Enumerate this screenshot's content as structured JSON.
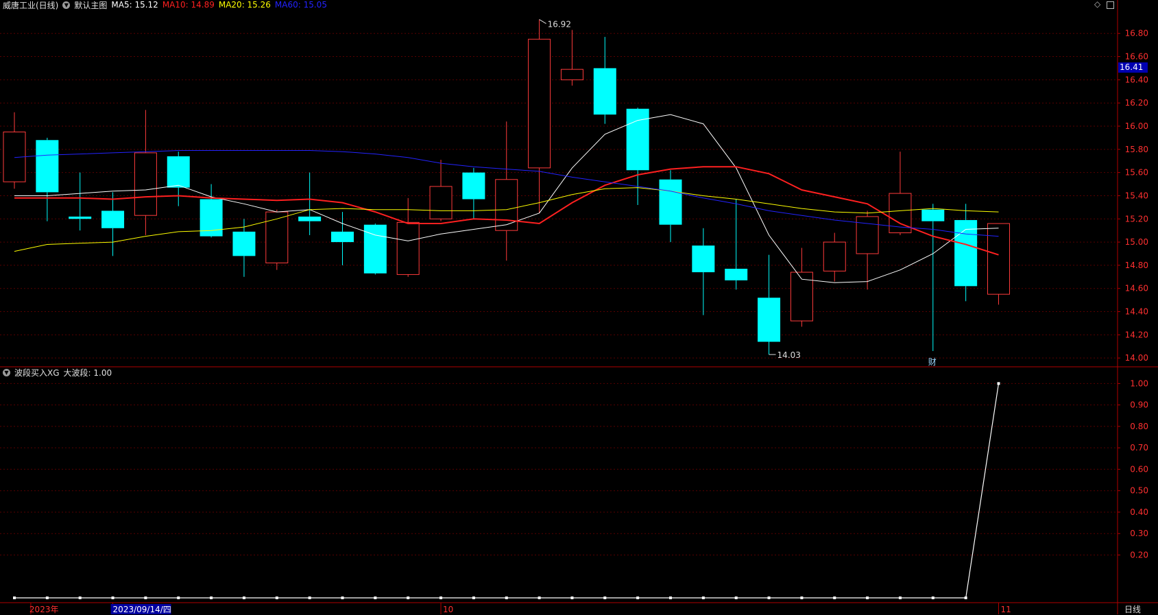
{
  "header": {
    "stock_title": "威唐工业(日线)",
    "main_chart_label": "默认主图",
    "ma": [
      {
        "label": "MA5: 15.12",
        "color": "#ffffff"
      },
      {
        "label": "MA10: 14.89",
        "color": "#ff2020"
      },
      {
        "label": "MA20: 15.26",
        "color": "#ffff00"
      },
      {
        "label": "MA60: 15.05",
        "color": "#2323ff"
      }
    ]
  },
  "sub_header": {
    "indicator_label": "波段买入XG",
    "value_label": "大波段: 1.00"
  },
  "price_badge": "16.41",
  "corner_label": "日线",
  "colors": {
    "up": "#ff3b3b",
    "down": "#00ffff",
    "grid": "#5a0000",
    "axis": "#b00000"
  },
  "chart_data": [
    {
      "type": "candlestick",
      "title": "",
      "yticks": [
        "14.00",
        "14.20",
        "14.40",
        "14.60",
        "14.80",
        "15.00",
        "15.20",
        "15.40",
        "15.60",
        "15.80",
        "16.00",
        "16.20",
        "16.40",
        "16.60",
        "16.80"
      ],
      "ylim": [
        13.93,
        16.97
      ],
      "high_label": "16.92",
      "low_label": "14.03",
      "event_marker": "财",
      "x_labels": [
        {
          "text": "2023年",
          "index": 0.5
        },
        {
          "text": "2023/09/14/四",
          "index": 3
        },
        {
          "text": "10",
          "index": 13
        },
        {
          "text": "11",
          "index": 30
        }
      ],
      "candles": [
        {
          "o": 15.52,
          "h": 16.12,
          "l": 15.46,
          "c": 15.95
        },
        {
          "o": 15.88,
          "h": 15.9,
          "l": 15.18,
          "c": 15.43
        },
        {
          "o": 15.22,
          "h": 15.6,
          "l": 15.1,
          "c": 15.2
        },
        {
          "o": 15.27,
          "h": 15.43,
          "l": 14.88,
          "c": 15.12
        },
        {
          "o": 15.23,
          "h": 16.14,
          "l": 15.06,
          "c": 15.77
        },
        {
          "o": 15.74,
          "h": 15.78,
          "l": 15.31,
          "c": 15.47
        },
        {
          "o": 15.37,
          "h": 15.5,
          "l": 15.04,
          "c": 15.05
        },
        {
          "o": 15.09,
          "h": 15.2,
          "l": 14.7,
          "c": 14.88
        },
        {
          "o": 14.82,
          "h": 15.28,
          "l": 14.76,
          "c": 15.26
        },
        {
          "o": 15.22,
          "h": 15.6,
          "l": 15.06,
          "c": 15.18
        },
        {
          "o": 15.09,
          "h": 15.26,
          "l": 14.8,
          "c": 15.0
        },
        {
          "o": 15.15,
          "h": 15.16,
          "l": 14.72,
          "c": 14.73
        },
        {
          "o": 14.72,
          "h": 15.38,
          "l": 14.7,
          "c": 15.17
        },
        {
          "o": 15.2,
          "h": 15.71,
          "l": 15.18,
          "c": 15.48
        },
        {
          "o": 15.6,
          "h": 15.64,
          "l": 15.2,
          "c": 15.37
        },
        {
          "o": 15.1,
          "h": 16.04,
          "l": 14.84,
          "c": 15.54
        },
        {
          "o": 15.64,
          "h": 16.92,
          "l": 15.25,
          "c": 16.75
        },
        {
          "o": 16.4,
          "h": 16.83,
          "l": 16.35,
          "c": 16.49
        },
        {
          "o": 16.5,
          "h": 16.77,
          "l": 16.02,
          "c": 16.1
        },
        {
          "o": 16.15,
          "h": 16.16,
          "l": 15.32,
          "c": 15.62
        },
        {
          "o": 15.54,
          "h": 15.62,
          "l": 15.0,
          "c": 15.15
        },
        {
          "o": 14.97,
          "h": 15.12,
          "l": 14.37,
          "c": 14.74
        },
        {
          "o": 14.77,
          "h": 15.37,
          "l": 14.59,
          "c": 14.67
        },
        {
          "o": 14.52,
          "h": 14.89,
          "l": 14.03,
          "c": 14.14
        },
        {
          "o": 14.32,
          "h": 14.95,
          "l": 14.27,
          "c": 14.74
        },
        {
          "o": 14.75,
          "h": 15.08,
          "l": 14.66,
          "c": 15.0
        },
        {
          "o": 14.9,
          "h": 15.27,
          "l": 14.59,
          "c": 15.22
        },
        {
          "o": 15.08,
          "h": 15.78,
          "l": 15.06,
          "c": 15.42
        },
        {
          "o": 15.28,
          "h": 15.33,
          "l": 14.06,
          "c": 15.18
        },
        {
          "o": 15.19,
          "h": 15.33,
          "l": 14.49,
          "c": 14.62
        },
        {
          "o": 14.55,
          "h": 15.16,
          "l": 14.46,
          "c": 15.16
        }
      ],
      "series": [
        {
          "name": "MA5",
          "color": "#ffffff",
          "width": 1,
          "values": [
            15.4,
            15.4,
            15.42,
            15.44,
            15.45,
            15.49,
            15.39,
            15.33,
            15.26,
            15.28,
            15.16,
            15.06,
            15.01,
            15.07,
            15.11,
            15.15,
            15.25,
            15.64,
            15.93,
            16.05,
            16.1,
            16.02,
            15.64,
            15.06,
            14.68,
            14.65,
            14.66,
            14.76,
            14.9,
            15.11,
            15.12
          ]
        },
        {
          "name": "MA10",
          "color": "#ff2020",
          "width": 2,
          "values": [
            15.38,
            15.38,
            15.38,
            15.37,
            15.39,
            15.4,
            15.38,
            15.37,
            15.36,
            15.37,
            15.34,
            15.26,
            15.16,
            15.16,
            15.2,
            15.19,
            15.16,
            15.34,
            15.49,
            15.58,
            15.63,
            15.65,
            15.65,
            15.59,
            15.45,
            15.39,
            15.33,
            15.16,
            15.05,
            14.98,
            14.89
          ]
        },
        {
          "name": "MA20",
          "color": "#ffff00",
          "width": 1,
          "values": [
            14.92,
            14.98,
            14.99,
            15.0,
            15.05,
            15.09,
            15.1,
            15.13,
            15.2,
            15.28,
            15.29,
            15.28,
            15.28,
            15.27,
            15.27,
            15.28,
            15.34,
            15.41,
            15.46,
            15.47,
            15.44,
            15.4,
            15.37,
            15.33,
            15.29,
            15.26,
            15.25,
            15.27,
            15.29,
            15.27,
            15.26
          ]
        },
        {
          "name": "MA60",
          "color": "#2323ff",
          "width": 1,
          "values": [
            15.73,
            15.75,
            15.76,
            15.77,
            15.78,
            15.79,
            15.79,
            15.79,
            15.79,
            15.79,
            15.78,
            15.76,
            15.73,
            15.68,
            15.65,
            15.63,
            15.61,
            15.56,
            15.52,
            15.48,
            15.44,
            15.38,
            15.33,
            15.27,
            15.23,
            15.19,
            15.16,
            15.13,
            15.11,
            15.07,
            15.05
          ]
        }
      ]
    },
    {
      "type": "line",
      "title": "",
      "yticks": [
        "0.20",
        "0.30",
        "0.40",
        "0.50",
        "0.60",
        "0.70",
        "0.80",
        "0.90",
        "1.00"
      ],
      "ylim": [
        0,
        1.03
      ],
      "series": [
        {
          "name": "大波段",
          "color": "#ffffff",
          "values": [
            0,
            0,
            0,
            0,
            0,
            0,
            0,
            0,
            0,
            0,
            0,
            0,
            0,
            0,
            0,
            0,
            0,
            0,
            0,
            0,
            0,
            0,
            0,
            0,
            0,
            0,
            0,
            0,
            0,
            0,
            1.0
          ]
        }
      ]
    }
  ]
}
